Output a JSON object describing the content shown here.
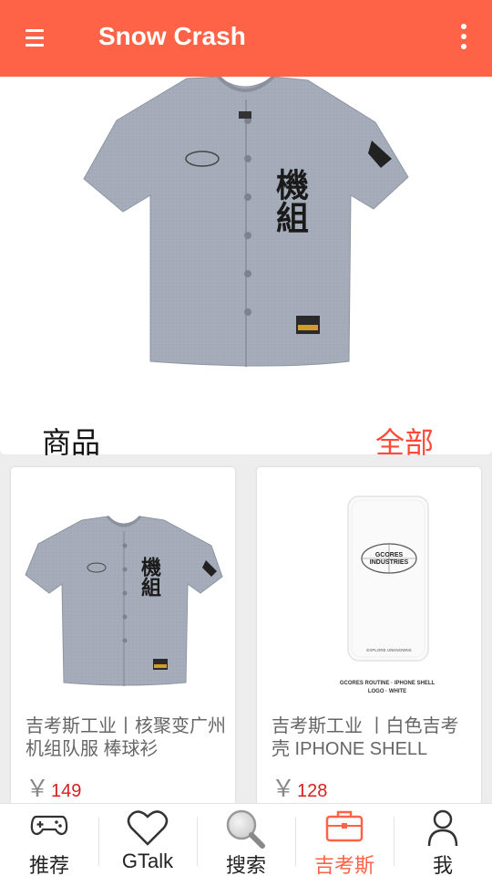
{
  "appbar": {
    "title": "Snow Crash"
  },
  "section": {
    "title": "商品",
    "all_label": "全部"
  },
  "products": [
    {
      "name": "吉考斯工业丨核聚变广州机组队服 棒球衫",
      "currency": "￥",
      "price": "149"
    },
    {
      "name": "吉考斯工业 丨白色吉考壳 IPHONE SHELL",
      "currency": "￥",
      "price": "128"
    }
  ],
  "phone_case": {
    "logo_line1": "GCORES",
    "logo_line2": "INDUSTRIES",
    "bottom_text": "EXPLORE UNKNOWNS",
    "caption_line1": "GCORES ROUTINE · IPHONE SHELL",
    "caption_line2": "LOGO · WHITE"
  },
  "jersey": {
    "chest_text": "機組"
  },
  "bottom_nav": [
    {
      "label": "推荐",
      "icon": "gamepad-icon"
    },
    {
      "label": "GTalk",
      "icon": "heart-icon"
    },
    {
      "label": "搜索",
      "icon": "search-icon"
    },
    {
      "label": "吉考斯",
      "icon": "briefcase-icon"
    },
    {
      "label": "我",
      "icon": "person-icon"
    }
  ],
  "colors": {
    "accent": "#ff6347",
    "price": "#d61f1f",
    "jersey": "#a6adba"
  }
}
